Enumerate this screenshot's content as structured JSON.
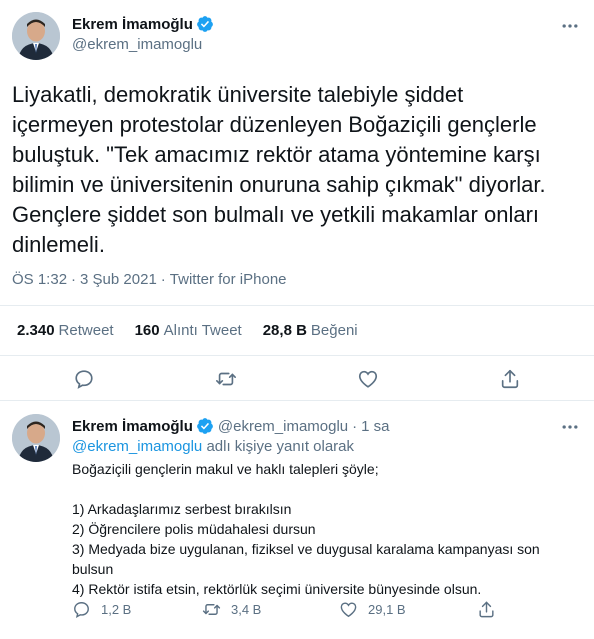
{
  "main_tweet": {
    "author_name": "Ekrem İmamoğlu",
    "author_handle": "@ekrem_imamoglu",
    "text": "Liyakatli, demokratik üniversite talebiyle şiddet\niçermeyen protestolar düzenleyen Boğaziçili gençlerle\nbuluştuk. \"Tek amacımız rektör atama yöntemine karşı\nbilimin ve üniversitenin onuruna sahip çıkmak\" diyorlar.\nGençlere şiddet son bulmalı ve yetkili makamlar onları\ndinlemeli.",
    "time": "ÖS 1:32",
    "date": "3 Şub 2021",
    "source": "Twitter for iPhone",
    "stats": {
      "retweets": "2.340",
      "retweets_label": "Retweet",
      "quotes": "160",
      "quotes_label": "Alıntı Tweet",
      "likes": "28,8 B",
      "likes_label": "Beğeni"
    }
  },
  "reply_tweet": {
    "author_name": "Ekrem İmamoğlu",
    "author_handle": "@ekrem_imamoglu",
    "time_ago": "1 sa",
    "reply_mention": "@ekrem_imamoglu",
    "reply_suffix": "adlı kişiye yanıt olarak",
    "lines": [
      "Boğaziçili gençlerin makul ve haklı talepleri şöyle;",
      "",
      "1) Arkadaşlarımız serbest bırakılsın",
      "2) Öğrencilere polis müdahalesi dursun",
      "3) Medyada bize uygulanan, fiziksel ve duygusal karalama kampanyası son",
      "bulsun",
      "4) Rektör istifa etsin, rektörlük seçimi üniversite bünyesinde olsun."
    ],
    "counts": {
      "replies": "1,2 B",
      "retweets": "3,4 B",
      "likes": "29,1 B"
    }
  },
  "colors": {
    "accent": "#1da1f2",
    "secondary_text": "#5b7083",
    "divider": "#e6ecf0"
  }
}
